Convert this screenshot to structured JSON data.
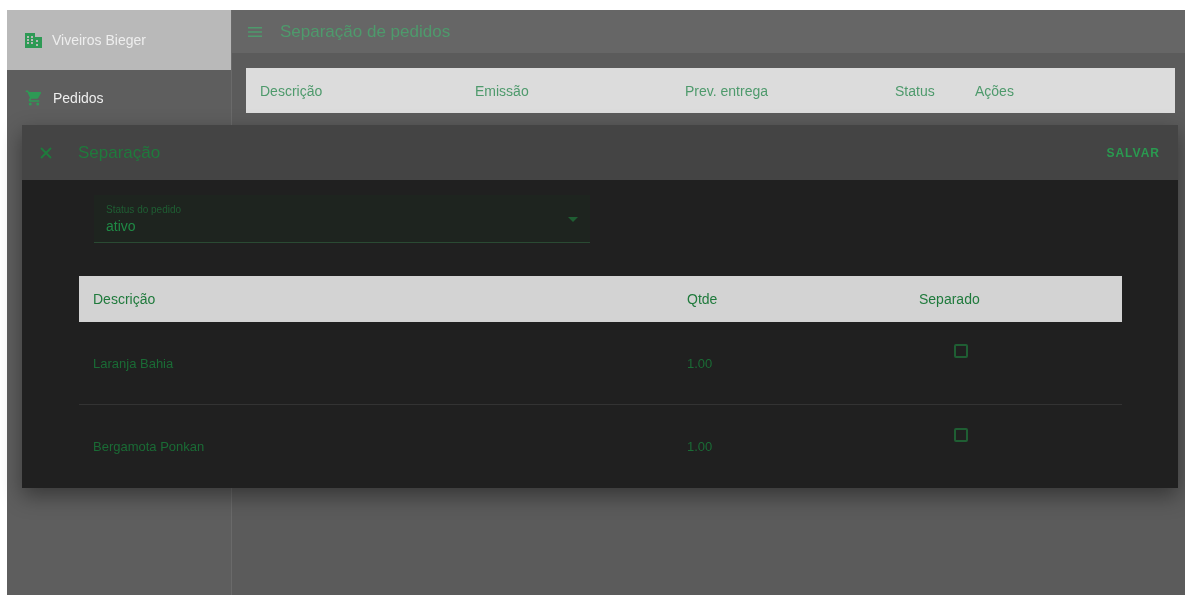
{
  "sidebar": {
    "items": [
      {
        "label": "Viveiros Bieger",
        "selected": true
      },
      {
        "label": "Pedidos",
        "selected": false
      }
    ]
  },
  "header": {
    "title": "Separação de pedidos"
  },
  "orders_table": {
    "columns": [
      "Descrição",
      "Emissão",
      "Prev. entrega",
      "Status",
      "Ações"
    ]
  },
  "dialog": {
    "title": "Separação",
    "save_button": "SALVAR",
    "status_field": {
      "label": "Status do pedido",
      "value": "ativo"
    },
    "items_table": {
      "columns": [
        "Descrição",
        "Qtde",
        "Separado"
      ],
      "rows": [
        {
          "description": "Laranja Bahia",
          "quantity": "1.00",
          "separated": false
        },
        {
          "description": "Bergamota Ponkan",
          "quantity": "1.00",
          "separated": false
        }
      ]
    }
  }
}
